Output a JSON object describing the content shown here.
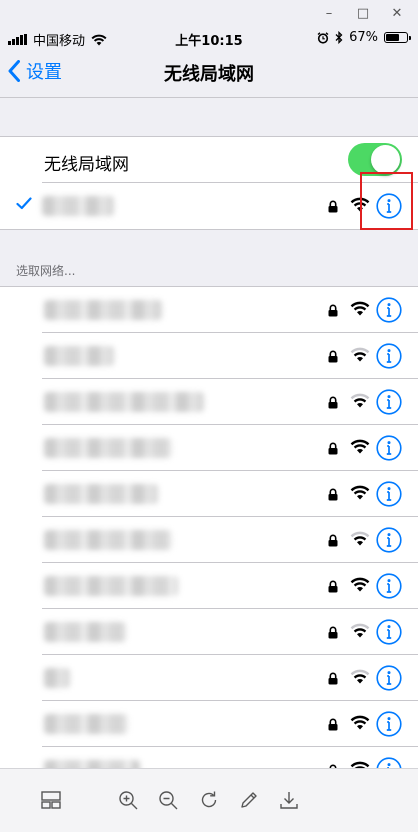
{
  "window_controls": {
    "minimize": "–",
    "maximize": "□",
    "close": "✕"
  },
  "status_bar": {
    "carrier": "中国移动",
    "time": "上午10:15",
    "battery_percent": "67%",
    "battery_level": 0.67,
    "icons": [
      "signal-icon",
      "wifi-icon",
      "alarm-icon",
      "bluetooth-icon",
      "battery-icon"
    ]
  },
  "nav": {
    "back_label": "设置",
    "title": "无线局域网"
  },
  "wifi_toggle": {
    "label": "无线局域网",
    "on": true
  },
  "connected_network": {
    "name": "",
    "secured": true,
    "signal": "full"
  },
  "section_header": "选取网络...",
  "networks": [
    {
      "name": "",
      "secured": true,
      "signal": "full"
    },
    {
      "name": "",
      "secured": true,
      "signal": "medium"
    },
    {
      "name": "",
      "secured": true,
      "signal": "medium"
    },
    {
      "name": "",
      "secured": true,
      "signal": "full"
    },
    {
      "name": "",
      "secured": true,
      "signal": "full"
    },
    {
      "name": "",
      "secured": true,
      "signal": "medium"
    },
    {
      "name": "",
      "secured": true,
      "signal": "full"
    },
    {
      "name": "",
      "secured": true,
      "signal": "medium"
    },
    {
      "name": "",
      "secured": true,
      "signal": "medium"
    },
    {
      "name": "",
      "secured": true,
      "signal": "full"
    },
    {
      "name": "",
      "secured": true,
      "signal": "full"
    }
  ],
  "toolbar_icons": [
    "layout-icon",
    "zoom-in-icon",
    "zoom-out-icon",
    "rotate-icon",
    "edit-icon",
    "download-icon"
  ],
  "colors": {
    "accent": "#007aff",
    "toggle_on": "#4cd964",
    "highlight": "#e02020"
  }
}
